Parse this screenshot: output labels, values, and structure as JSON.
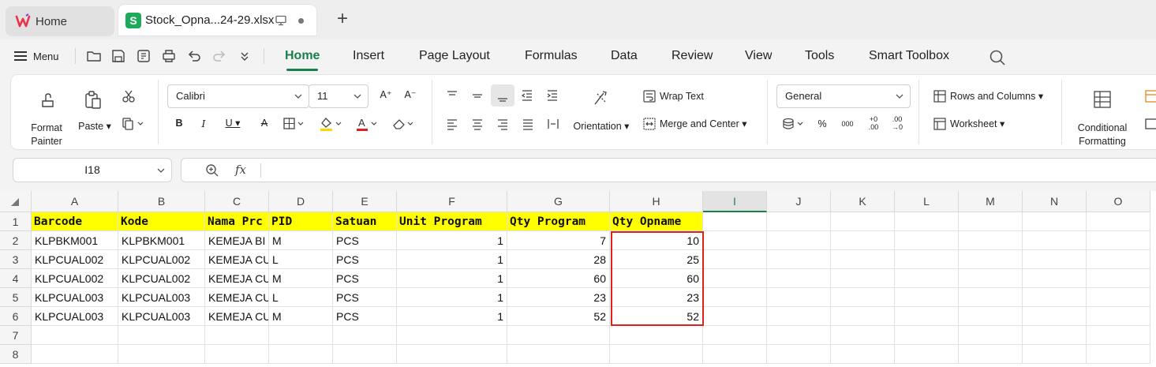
{
  "tabs": {
    "home_label": "Home",
    "file_label": "Stock_Opna...24-29.xlsx",
    "new_tab": "+"
  },
  "menu": {
    "menu_label": "Menu",
    "tabs": [
      "Home",
      "Insert",
      "Page Layout",
      "Formulas",
      "Data",
      "Review",
      "View",
      "Tools",
      "Smart Toolbox"
    ],
    "active_tab": "Home"
  },
  "ribbon": {
    "format_painter": "Format\nPainter",
    "paste": "Paste",
    "font_name": "Calibri",
    "font_size": "11",
    "orientation": "Orientation",
    "wrap_text": "Wrap Text",
    "merge_center": "Merge and Center",
    "number_format": "General",
    "percent": "%",
    "rows_columns": "Rows and Columns",
    "worksheet": "Worksheet",
    "conditional": "Conditional\nFormatting"
  },
  "formula_bar": {
    "name_box": "I18",
    "fx": "fx",
    "value": ""
  },
  "sheet": {
    "columns": [
      "A",
      "B",
      "C",
      "D",
      "E",
      "F",
      "G",
      "H",
      "I",
      "J",
      "K",
      "L",
      "M",
      "N",
      "O"
    ],
    "selected_column": "I",
    "rows": [
      "1",
      "2",
      "3",
      "4",
      "5",
      "6",
      "7",
      "8"
    ],
    "header": [
      "Barcode",
      "Kode",
      "Nama Prc",
      "PID",
      "Satuan",
      "Unit Program",
      "Qty Program",
      "Qty Opname"
    ],
    "data": [
      [
        "KLPBKM001",
        "KLPBKM001",
        "KEMEJA BI",
        "M",
        "PCS",
        "1",
        "7",
        "10"
      ],
      [
        "KLPCUAL002",
        "KLPCUAL002",
        "KEMEJA CU",
        "L",
        "PCS",
        "1",
        "28",
        "25"
      ],
      [
        "KLPCUAL002",
        "KLPCUAL002",
        "KEMEJA CU",
        "M",
        "PCS",
        "1",
        "60",
        "60"
      ],
      [
        "KLPCUAL003",
        "KLPCUAL003",
        "KEMEJA CU",
        "L",
        "PCS",
        "1",
        "23",
        "23"
      ],
      [
        "KLPCUAL003",
        "KLPCUAL003",
        "KEMEJA CU",
        "M",
        "PCS",
        "1",
        "52",
        "52"
      ]
    ],
    "highlight_color": "#ffff00",
    "annotation_color": "#e0201f",
    "accent_color": "#1a7f4b"
  }
}
